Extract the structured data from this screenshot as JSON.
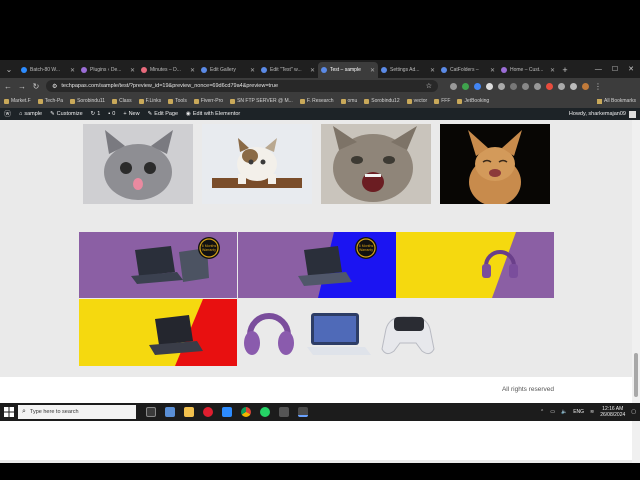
{
  "browser": {
    "tabs": [
      {
        "label": "Batch-80 W...",
        "color": "#2d8cff"
      },
      {
        "label": "Plugins ‹ De...",
        "color": "#9b6dd6"
      },
      {
        "label": "Minutes – D...",
        "color": "#e86a7c"
      },
      {
        "label": "Edit Gallery",
        "color": "#5b8ae6"
      },
      {
        "label": "Edit \"Test\" w...",
        "color": "#5b8ae6"
      },
      {
        "label": "Test – sample",
        "color": "#5b8ae6"
      },
      {
        "label": "Settings Ad...",
        "color": "#5b8ae6"
      },
      {
        "label": "CatFolders –",
        "color": "#5b8ae6"
      },
      {
        "label": "Home – Cust...",
        "color": "#9b6dd6"
      }
    ],
    "active_tab_index": 5,
    "url": "techpapas.com/sample/test/?preview_id=19&preview_nonce=69d6cd79a4&preview=true",
    "bookmarks": [
      "Market.F",
      "Tech-Pa",
      "Sorobindu11",
      "Class",
      "F.Links",
      "Tools",
      "Fiverr-Pro",
      "SN FTP SERVER @ M...",
      "F. Research",
      "omu",
      "Sorobindu12",
      "vector",
      "FFF",
      "JetBooking"
    ],
    "all_bookmarks": "All Bookmarks"
  },
  "wpbar": {
    "site": "sample",
    "customize": "Customize",
    "comments": "1",
    "zero": "0",
    "new": "New",
    "edit_page": "Edit Page",
    "elementor": "Edit with Elementor",
    "howdy": "Howdy, sharkemajan09"
  },
  "page": {
    "footer_text": "All rights reserved",
    "banner_badge": "6 Months Warranty",
    "colors": {
      "purple": "#8b5fa4",
      "yellow": "#f5d90f",
      "blue": "#1b14f2",
      "red": "#e81010"
    }
  },
  "taskbar": {
    "search_placeholder": "Type here to search",
    "lang": "ENG",
    "time": "12:16 AM",
    "date": "26/08/2024"
  }
}
